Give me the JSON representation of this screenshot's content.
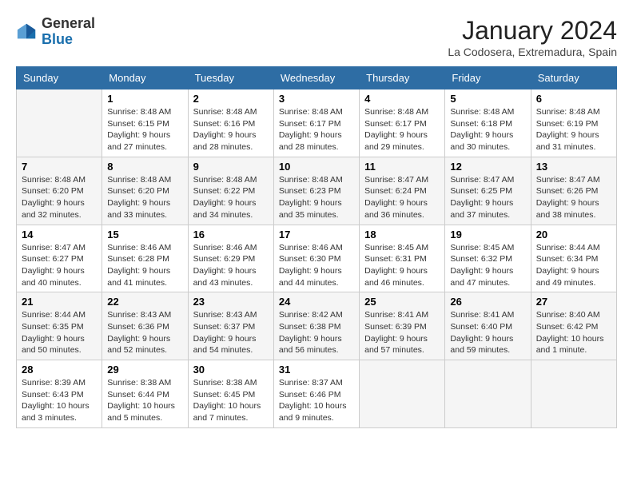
{
  "header": {
    "logo_general": "General",
    "logo_blue": "Blue",
    "title": "January 2024",
    "subtitle": "La Codosera, Extremadura, Spain"
  },
  "weekdays": [
    "Sunday",
    "Monday",
    "Tuesday",
    "Wednesday",
    "Thursday",
    "Friday",
    "Saturday"
  ],
  "weeks": [
    [
      {
        "day": "",
        "sunrise": "",
        "sunset": "",
        "daylight": ""
      },
      {
        "day": "1",
        "sunrise": "Sunrise: 8:48 AM",
        "sunset": "Sunset: 6:15 PM",
        "daylight": "Daylight: 9 hours and 27 minutes."
      },
      {
        "day": "2",
        "sunrise": "Sunrise: 8:48 AM",
        "sunset": "Sunset: 6:16 PM",
        "daylight": "Daylight: 9 hours and 28 minutes."
      },
      {
        "day": "3",
        "sunrise": "Sunrise: 8:48 AM",
        "sunset": "Sunset: 6:17 PM",
        "daylight": "Daylight: 9 hours and 28 minutes."
      },
      {
        "day": "4",
        "sunrise": "Sunrise: 8:48 AM",
        "sunset": "Sunset: 6:17 PM",
        "daylight": "Daylight: 9 hours and 29 minutes."
      },
      {
        "day": "5",
        "sunrise": "Sunrise: 8:48 AM",
        "sunset": "Sunset: 6:18 PM",
        "daylight": "Daylight: 9 hours and 30 minutes."
      },
      {
        "day": "6",
        "sunrise": "Sunrise: 8:48 AM",
        "sunset": "Sunset: 6:19 PM",
        "daylight": "Daylight: 9 hours and 31 minutes."
      }
    ],
    [
      {
        "day": "7",
        "sunrise": "Sunrise: 8:48 AM",
        "sunset": "Sunset: 6:20 PM",
        "daylight": "Daylight: 9 hours and 32 minutes."
      },
      {
        "day": "8",
        "sunrise": "Sunrise: 8:48 AM",
        "sunset": "Sunset: 6:20 PM",
        "daylight": "Daylight: 9 hours and 33 minutes."
      },
      {
        "day": "9",
        "sunrise": "Sunrise: 8:48 AM",
        "sunset": "Sunset: 6:22 PM",
        "daylight": "Daylight: 9 hours and 34 minutes."
      },
      {
        "day": "10",
        "sunrise": "Sunrise: 8:48 AM",
        "sunset": "Sunset: 6:23 PM",
        "daylight": "Daylight: 9 hours and 35 minutes."
      },
      {
        "day": "11",
        "sunrise": "Sunrise: 8:47 AM",
        "sunset": "Sunset: 6:24 PM",
        "daylight": "Daylight: 9 hours and 36 minutes."
      },
      {
        "day": "12",
        "sunrise": "Sunrise: 8:47 AM",
        "sunset": "Sunset: 6:25 PM",
        "daylight": "Daylight: 9 hours and 37 minutes."
      },
      {
        "day": "13",
        "sunrise": "Sunrise: 8:47 AM",
        "sunset": "Sunset: 6:26 PM",
        "daylight": "Daylight: 9 hours and 38 minutes."
      }
    ],
    [
      {
        "day": "14",
        "sunrise": "Sunrise: 8:47 AM",
        "sunset": "Sunset: 6:27 PM",
        "daylight": "Daylight: 9 hours and 40 minutes."
      },
      {
        "day": "15",
        "sunrise": "Sunrise: 8:46 AM",
        "sunset": "Sunset: 6:28 PM",
        "daylight": "Daylight: 9 hours and 41 minutes."
      },
      {
        "day": "16",
        "sunrise": "Sunrise: 8:46 AM",
        "sunset": "Sunset: 6:29 PM",
        "daylight": "Daylight: 9 hours and 43 minutes."
      },
      {
        "day": "17",
        "sunrise": "Sunrise: 8:46 AM",
        "sunset": "Sunset: 6:30 PM",
        "daylight": "Daylight: 9 hours and 44 minutes."
      },
      {
        "day": "18",
        "sunrise": "Sunrise: 8:45 AM",
        "sunset": "Sunset: 6:31 PM",
        "daylight": "Daylight: 9 hours and 46 minutes."
      },
      {
        "day": "19",
        "sunrise": "Sunrise: 8:45 AM",
        "sunset": "Sunset: 6:32 PM",
        "daylight": "Daylight: 9 hours and 47 minutes."
      },
      {
        "day": "20",
        "sunrise": "Sunrise: 8:44 AM",
        "sunset": "Sunset: 6:34 PM",
        "daylight": "Daylight: 9 hours and 49 minutes."
      }
    ],
    [
      {
        "day": "21",
        "sunrise": "Sunrise: 8:44 AM",
        "sunset": "Sunset: 6:35 PM",
        "daylight": "Daylight: 9 hours and 50 minutes."
      },
      {
        "day": "22",
        "sunrise": "Sunrise: 8:43 AM",
        "sunset": "Sunset: 6:36 PM",
        "daylight": "Daylight: 9 hours and 52 minutes."
      },
      {
        "day": "23",
        "sunrise": "Sunrise: 8:43 AM",
        "sunset": "Sunset: 6:37 PM",
        "daylight": "Daylight: 9 hours and 54 minutes."
      },
      {
        "day": "24",
        "sunrise": "Sunrise: 8:42 AM",
        "sunset": "Sunset: 6:38 PM",
        "daylight": "Daylight: 9 hours and 56 minutes."
      },
      {
        "day": "25",
        "sunrise": "Sunrise: 8:41 AM",
        "sunset": "Sunset: 6:39 PM",
        "daylight": "Daylight: 9 hours and 57 minutes."
      },
      {
        "day": "26",
        "sunrise": "Sunrise: 8:41 AM",
        "sunset": "Sunset: 6:40 PM",
        "daylight": "Daylight: 9 hours and 59 minutes."
      },
      {
        "day": "27",
        "sunrise": "Sunrise: 8:40 AM",
        "sunset": "Sunset: 6:42 PM",
        "daylight": "Daylight: 10 hours and 1 minute."
      }
    ],
    [
      {
        "day": "28",
        "sunrise": "Sunrise: 8:39 AM",
        "sunset": "Sunset: 6:43 PM",
        "daylight": "Daylight: 10 hours and 3 minutes."
      },
      {
        "day": "29",
        "sunrise": "Sunrise: 8:38 AM",
        "sunset": "Sunset: 6:44 PM",
        "daylight": "Daylight: 10 hours and 5 minutes."
      },
      {
        "day": "30",
        "sunrise": "Sunrise: 8:38 AM",
        "sunset": "Sunset: 6:45 PM",
        "daylight": "Daylight: 10 hours and 7 minutes."
      },
      {
        "day": "31",
        "sunrise": "Sunrise: 8:37 AM",
        "sunset": "Sunset: 6:46 PM",
        "daylight": "Daylight: 10 hours and 9 minutes."
      },
      {
        "day": "",
        "sunrise": "",
        "sunset": "",
        "daylight": ""
      },
      {
        "day": "",
        "sunrise": "",
        "sunset": "",
        "daylight": ""
      },
      {
        "day": "",
        "sunrise": "",
        "sunset": "",
        "daylight": ""
      }
    ]
  ]
}
